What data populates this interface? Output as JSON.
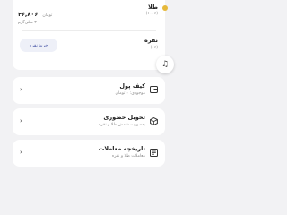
{
  "assets": {
    "gold": {
      "title": "طلا",
      "subtitle": "(۱۰۰٪)",
      "amount_value": "۴۶,۸۰۶",
      "amount_unit": "تومان",
      "weight": "۳ میلی‌گرم",
      "color": "#e6b93b"
    },
    "silver": {
      "title": "نقره",
      "subtitle": "(۰٪)",
      "buy_button": "خرید نقره"
    }
  },
  "floating_button": {
    "icon": "music-note-icon"
  },
  "menu": [
    {
      "title": "کیف پول",
      "subtitle": "موجودی: ۰ تومان",
      "icon": "wallet-icon"
    },
    {
      "title": "تحویل حضوری",
      "subtitle": "به‌صورت شمش طلا و نقره",
      "icon": "delivery-box-icon"
    },
    {
      "title": "تاریخچه معاملات",
      "subtitle": "معاملات طلا و نقره",
      "icon": "history-icon"
    }
  ],
  "colors": {
    "accent": "#4a58a8",
    "background": "#f2f2f4"
  }
}
